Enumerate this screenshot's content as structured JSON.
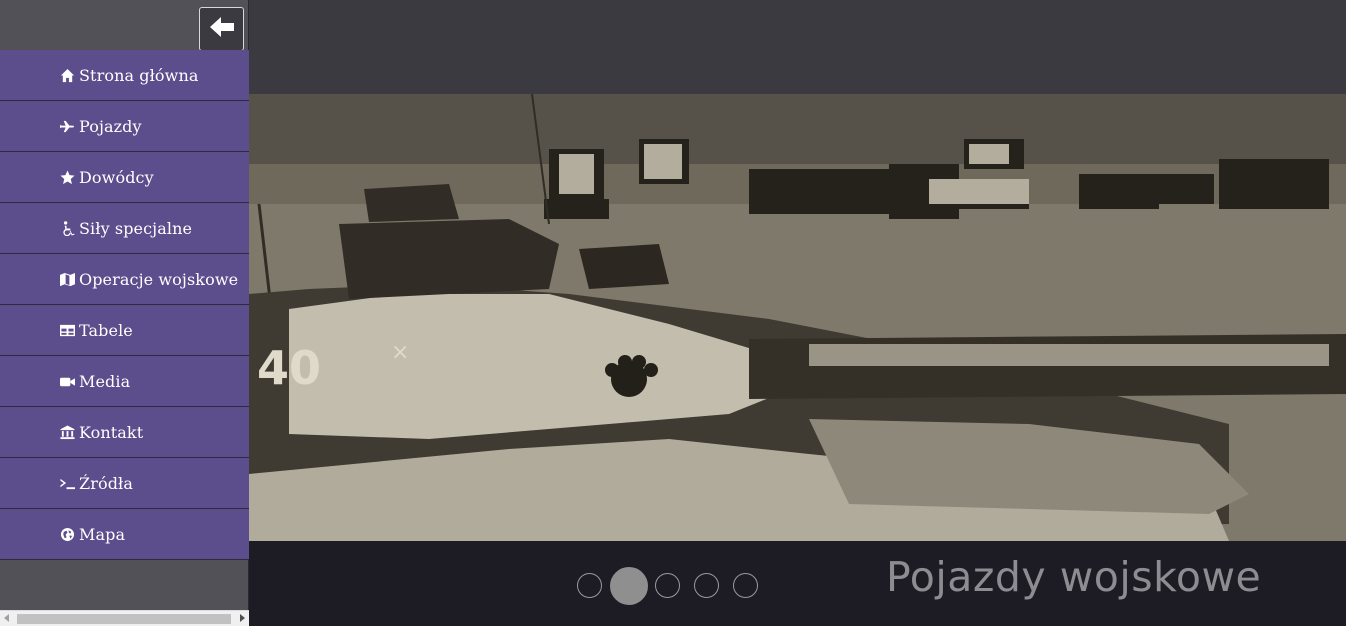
{
  "sidebar": {
    "back_icon": "arrow-left-icon",
    "items": [
      {
        "label": "Strona główna",
        "icon": "home-icon"
      },
      {
        "label": "Pojazdy",
        "icon": "plane-icon"
      },
      {
        "label": "Dowódcy",
        "icon": "star-icon"
      },
      {
        "label": "Siły specjalne",
        "icon": "wheelchair-icon"
      },
      {
        "label": "Operacje wojskowe",
        "icon": "map-icon"
      },
      {
        "label": "Tabele",
        "icon": "table-icon"
      },
      {
        "label": "Media",
        "icon": "video-camera-icon"
      },
      {
        "label": "Kontakt",
        "icon": "bank-icon"
      },
      {
        "label": "Źródła",
        "icon": "terminal-icon"
      },
      {
        "label": "Mapa",
        "icon": "globe-icon"
      }
    ]
  },
  "slider": {
    "caption": "Pojazdy wojskowe",
    "dot_count": 5,
    "active_index": 1
  },
  "colors": {
    "menu_bg": "#5c4d8c",
    "sidebar_bg": "#535158",
    "slider_bg": "#1d1b24",
    "header_bg": "#3b3a40"
  }
}
